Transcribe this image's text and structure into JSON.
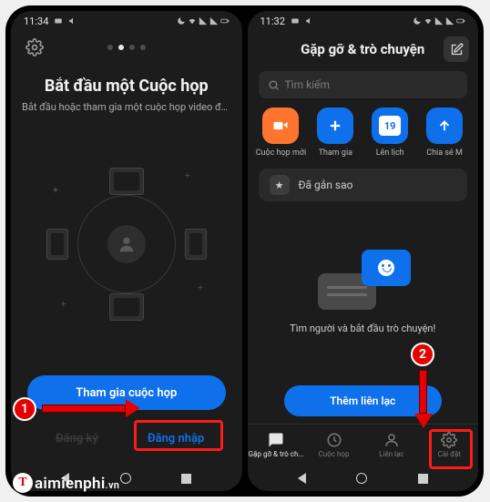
{
  "left": {
    "status_time": "11:34",
    "title": "Bắt đầu một Cuộc họp",
    "subtitle": "Bắt đầu hoặc tham gia một cuộc họp video đan...",
    "join_button": "Tham gia cuộc họp",
    "signup_label": "Đăng ký",
    "signin_label": "Đăng nhập"
  },
  "right": {
    "status_time": "11:32",
    "header_title": "Gặp gỡ & trò chuyện",
    "search_placeholder": "Tìm kiếm",
    "actions": {
      "new_meeting": "Cuộc họp mới",
      "join": "Tham gia",
      "schedule": "Lên lịch",
      "schedule_day": "19",
      "share": "Chia sẻ M"
    },
    "starred_label": "Đã gắn sao",
    "empty_text": "Tìm người và bắt đầu trò chuyện!",
    "add_contact": "Thêm liên lạc",
    "tabs": {
      "chat": "Gặp gỡ & trò ch...",
      "meeting": "Cuộc họp",
      "contacts": "Liên lạc",
      "settings": "Cài đặt"
    }
  },
  "annotations": {
    "badge1": "1",
    "badge2": "2"
  },
  "watermark": {
    "letter": "T",
    "text": "aimienphi",
    "suffix": ".vn"
  }
}
